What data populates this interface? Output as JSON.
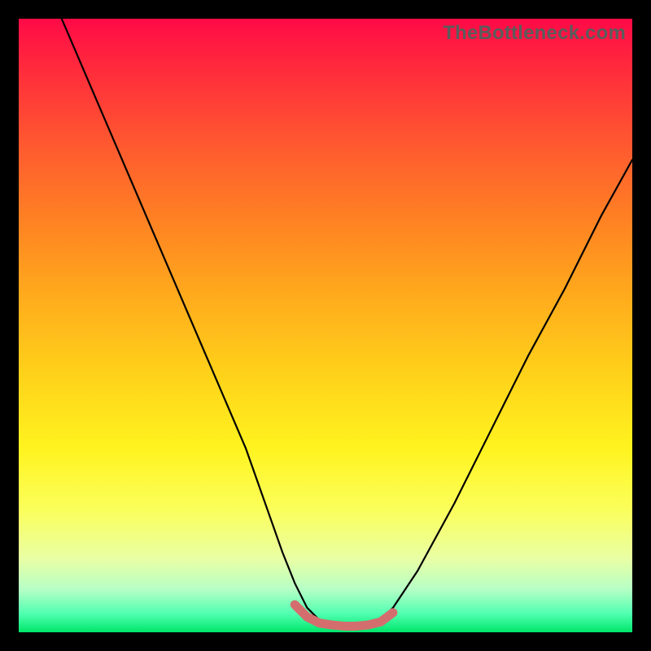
{
  "watermark": "TheBottleneck.com",
  "chart_data": {
    "type": "line",
    "title": "",
    "xlabel": "",
    "ylabel": "",
    "xlim": [
      0,
      100
    ],
    "ylim": [
      0,
      100
    ],
    "series": [
      {
        "name": "curve",
        "x": [
          7,
          13,
          19,
          25,
          31,
          37,
          43,
          45,
          47,
          49,
          51,
          53,
          55,
          57,
          59,
          61,
          65,
          71,
          77,
          83,
          89,
          95,
          100
        ],
        "values": [
          100,
          86,
          72,
          58,
          44,
          30,
          13,
          8,
          4,
          2,
          1,
          0.7,
          0.7,
          1,
          2,
          4,
          10,
          21,
          33,
          45,
          56,
          68,
          77
        ]
      },
      {
        "name": "bottom-highlight",
        "x": [
          45,
          47,
          49,
          51,
          53,
          55,
          57,
          59,
          61
        ],
        "values": [
          4.5,
          2.5,
          1.5,
          1.2,
          1.0,
          1.0,
          1.2,
          1.7,
          3.2
        ]
      }
    ],
    "colors": {
      "curve": "#000000",
      "highlight": "#d46e6e"
    }
  }
}
